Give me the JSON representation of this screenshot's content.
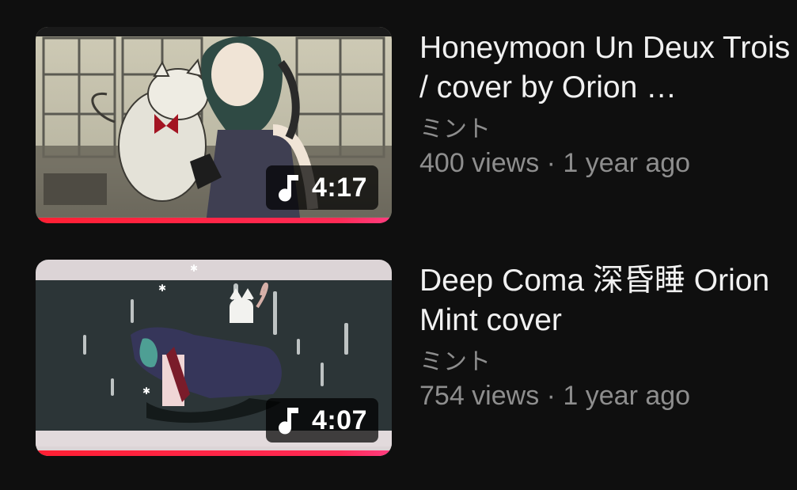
{
  "videos": [
    {
      "title": "Honeymoon Un Deux Trois / cover by Orion …",
      "channel": "ミント",
      "views": "400 views",
      "separator": " · ",
      "age": "1 year ago",
      "duration": "4:17",
      "duration_icon": "music-note-icon",
      "watched_progress": 1.0
    },
    {
      "title": "Deep Coma 深昏睡 Orion Mint cover",
      "channel": "ミント",
      "views": "754 views",
      "separator": " · ",
      "age": "1 year ago",
      "duration": "4:07",
      "duration_icon": "music-note-icon",
      "watched_progress": 1.0
    }
  ],
  "colors": {
    "background": "#0f0f0f",
    "title_text": "#f1f1f1",
    "secondary_text": "#8e8e8e",
    "progress": "#ff1f33"
  }
}
